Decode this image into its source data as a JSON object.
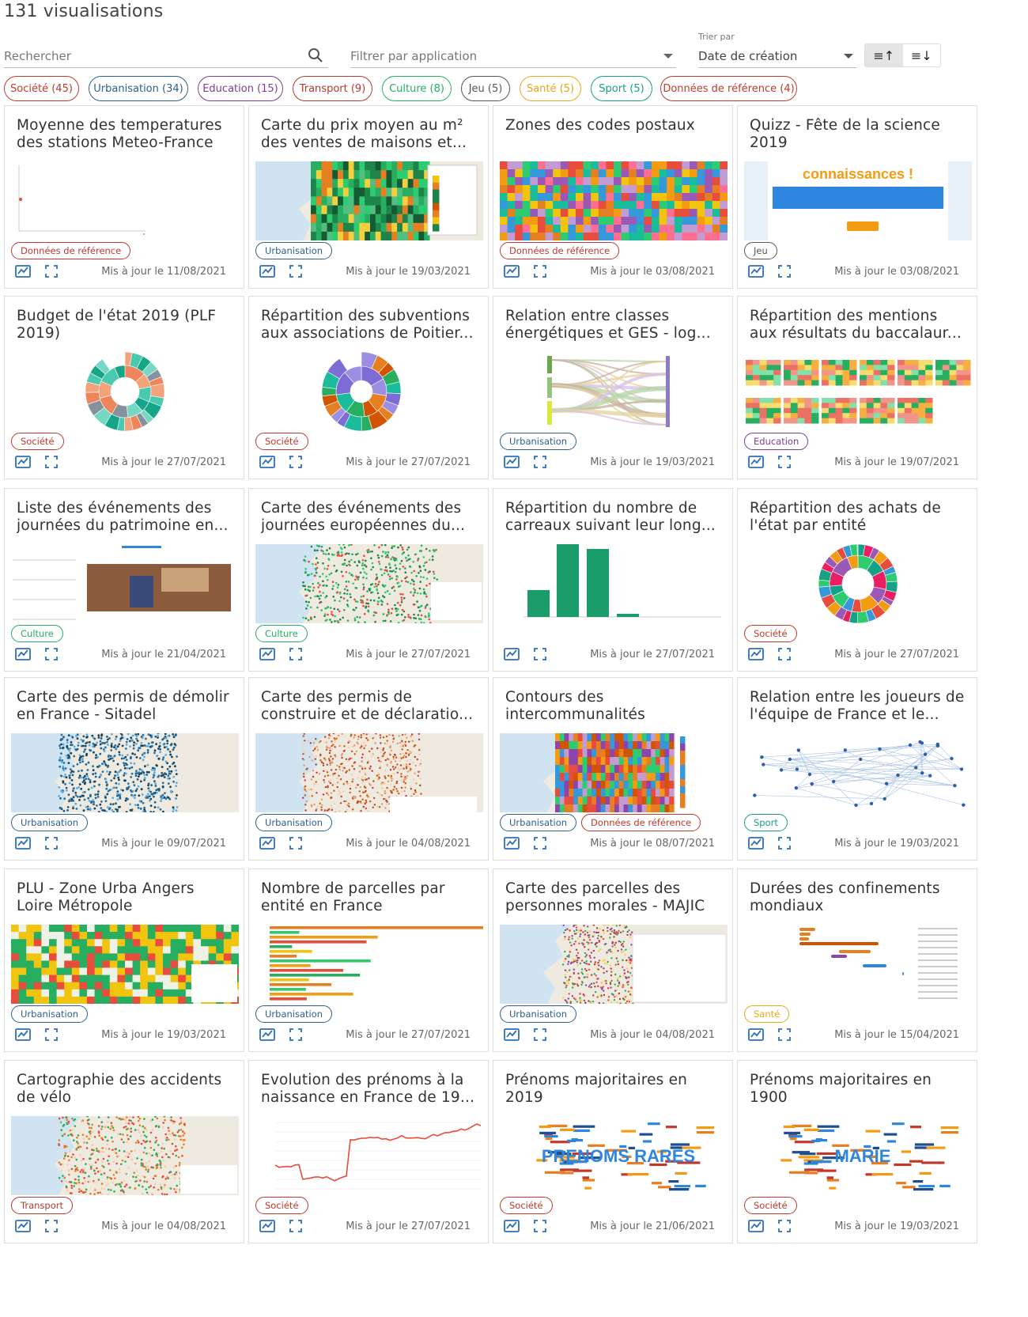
{
  "header": {
    "count_title": "131 visualisations"
  },
  "filters": {
    "search_placeholder": "Rechercher",
    "app_filter_placeholder": "Filtrer par application",
    "sort_label": "Trier par",
    "sort_value": "Date de création",
    "sort_asc_glyph": "≡↑",
    "sort_desc_glyph": "≡↓"
  },
  "chips": [
    {
      "label": "Société (45)",
      "color": "#c0392b"
    },
    {
      "label": "Urbanisation (34)",
      "color": "#2b5f8f"
    },
    {
      "label": "Education (15)",
      "color": "#7d3c98"
    },
    {
      "label": "Transport (9)",
      "color": "#b03a2e"
    },
    {
      "label": "Culture (8)",
      "color": "#27ae60"
    },
    {
      "label": "Jeu (5)",
      "color": "#555555"
    },
    {
      "label": "Santé (5)",
      "color": "#e6a817"
    },
    {
      "label": "Sport (5)",
      "color": "#16a085"
    },
    {
      "label": "Données de référence (4)",
      "color": "#c0392b"
    }
  ],
  "cards": [
    {
      "title": "Moyenne des temperatures des stations Meteo-France",
      "tags": [
        {
          "label": "Données de référence",
          "color": "#c0392b"
        }
      ],
      "updated": "Mis à jour le 11/08/2021",
      "thumb": "line-chart"
    },
    {
      "title": "Carte du prix moyen au m² des ventes de maisons et...",
      "tags": [
        {
          "label": "Urbanisation",
          "color": "#2b5f8f"
        }
      ],
      "updated": "Mis à jour le 19/03/2021",
      "thumb": "map-green"
    },
    {
      "title": "Zones des codes postaux",
      "tags": [
        {
          "label": "Données de référence",
          "color": "#c0392b"
        }
      ],
      "updated": "Mis à jour le 03/08/2021",
      "thumb": "map-colorful"
    },
    {
      "title": "Quizz - Fête de la science 2019",
      "tags": [
        {
          "label": "Jeu",
          "color": "#555555"
        }
      ],
      "updated": "Mis à jour le 03/08/2021",
      "thumb": "quiz",
      "thumb_text": "connaissances !"
    },
    {
      "title": "Budget de l'état 2019 (PLF 2019)",
      "tags": [
        {
          "label": "Société",
          "color": "#c0392b"
        }
      ],
      "updated": "Mis à jour le 27/07/2021",
      "thumb": "sunburst-orange"
    },
    {
      "title": "Répartition des subventions aux associations de Poitier...",
      "tags": [
        {
          "label": "Société",
          "color": "#c0392b"
        }
      ],
      "updated": "Mis à jour le 27/07/2021",
      "thumb": "sunburst-purple"
    },
    {
      "title": "Relation entre classes énergétiques et GES - log...",
      "tags": [
        {
          "label": "Urbanisation",
          "color": "#2b5f8f"
        }
      ],
      "updated": "Mis à jour le 19/03/2021",
      "thumb": "sankey"
    },
    {
      "title": "Répartition des mentions aux résultats du baccalaur...",
      "tags": [
        {
          "label": "Education",
          "color": "#7d3c98"
        }
      ],
      "updated": "Mis à jour le 19/07/2021",
      "thumb": "heatmap"
    },
    {
      "title": "Liste des événements des journées du patrimoine en...",
      "tags": [
        {
          "label": "Culture",
          "color": "#27ae60"
        }
      ],
      "updated": "Mis à jour le 21/04/2021",
      "thumb": "list"
    },
    {
      "title": "Carte des événements des journées européennes du...",
      "tags": [
        {
          "label": "Culture",
          "color": "#27ae60"
        }
      ],
      "updated": "Mis à jour le 27/07/2021",
      "thumb": "map-points-green"
    },
    {
      "title": "Répartition du nombre de carreaux suivant leur long...",
      "tags": [],
      "updated": "Mis à jour le 27/07/2021",
      "thumb": "bars"
    },
    {
      "title": "Répartition des achats de l'état par entité",
      "tags": [
        {
          "label": "Société",
          "color": "#c0392b"
        }
      ],
      "updated": "Mis à jour le 27/07/2021",
      "thumb": "sunburst-multi"
    },
    {
      "title": "Carte des permis de démolir en France - Sitadel",
      "tags": [
        {
          "label": "Urbanisation",
          "color": "#2b5f8f"
        }
      ],
      "updated": "Mis à jour le 09/07/2021",
      "thumb": "map-blue"
    },
    {
      "title": "Carte des permis de construire et de déclaratio...",
      "tags": [
        {
          "label": "Urbanisation",
          "color": "#2b5f8f"
        }
      ],
      "updated": "Mis à jour le 04/08/2021",
      "thumb": "map-red-dots"
    },
    {
      "title": "Contours des intercommunalités",
      "tags": [
        {
          "label": "Urbanisation",
          "color": "#2b5f8f"
        },
        {
          "label": "Données de référence",
          "color": "#c0392b"
        }
      ],
      "updated": "Mis à jour le 08/07/2021",
      "thumb": "map-mosaic"
    },
    {
      "title": "Relation entre les joueurs de l'équipe de France et le...",
      "tags": [
        {
          "label": "Sport",
          "color": "#16a085"
        }
      ],
      "updated": "Mis à jour le 19/03/2021",
      "thumb": "network"
    },
    {
      "title": "PLU - Zone Urba Angers Loire Métropole",
      "tags": [
        {
          "label": "Urbanisation",
          "color": "#2b5f8f"
        }
      ],
      "updated": "Mis à jour le 19/03/2021",
      "thumb": "map-plu"
    },
    {
      "title": "Nombre de parcelles par entité en France",
      "tags": [
        {
          "label": "Urbanisation",
          "color": "#2b5f8f"
        }
      ],
      "updated": "Mis à jour le 27/07/2021",
      "thumb": "hbars"
    },
    {
      "title": "Carte des parcelles des personnes morales - MAJIC",
      "tags": [
        {
          "label": "Urbanisation",
          "color": "#2b5f8f"
        }
      ],
      "updated": "Mis à jour le 04/08/2021",
      "thumb": "map-parcels"
    },
    {
      "title": "Durées des confinements mondiaux",
      "tags": [
        {
          "label": "Santé",
          "color": "#e6a817"
        }
      ],
      "updated": "Mis à jour le 15/04/2021",
      "thumb": "gantt"
    },
    {
      "title": "Cartographie des accidents de vélo",
      "tags": [
        {
          "label": "Transport",
          "color": "#b03a2e"
        }
      ],
      "updated": "Mis à jour le 04/08/2021",
      "thumb": "map-accidents"
    },
    {
      "title": "Evolution des prénoms à la naissance en France de 19...",
      "tags": [
        {
          "label": "Société",
          "color": "#c0392b"
        }
      ],
      "updated": "Mis à jour le 27/07/2021",
      "thumb": "line-red"
    },
    {
      "title": "Prénoms majoritaires en 2019",
      "tags": [
        {
          "label": "Société",
          "color": "#c0392b"
        }
      ],
      "updated": "Mis à jour le 21/06/2021",
      "thumb": "wordcloud",
      "thumb_text": "PRENOMS RARES"
    },
    {
      "title": "Prénoms majoritaires en 1900",
      "tags": [
        {
          "label": "Société",
          "color": "#c0392b"
        }
      ],
      "updated": "Mis à jour le 19/03/2021",
      "thumb": "wordcloud",
      "thumb_text": "MARIE"
    }
  ],
  "icons": {
    "view": "chart-view-icon",
    "expand": "expand-icon",
    "search": "search-icon"
  }
}
